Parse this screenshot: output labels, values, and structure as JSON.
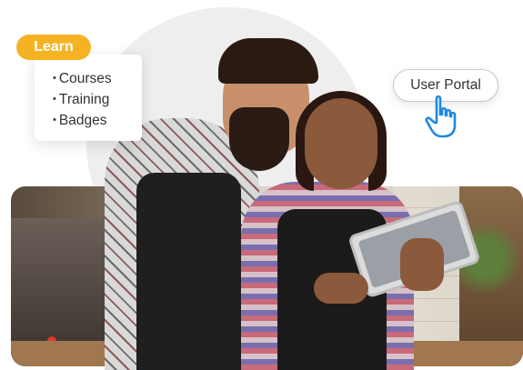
{
  "learn": {
    "badge_label": "Learn",
    "items": [
      {
        "label": "Courses"
      },
      {
        "label": "Training"
      },
      {
        "label": "Badges"
      }
    ]
  },
  "portal": {
    "label": "User Portal",
    "pointer_icon": "hand-pointer-icon"
  },
  "colors": {
    "badge_bg": "#f5b324",
    "badge_text": "#ffffff",
    "pointer": "#1e88e5"
  },
  "photo": {
    "icon": "baristas-with-tablet-photo"
  }
}
